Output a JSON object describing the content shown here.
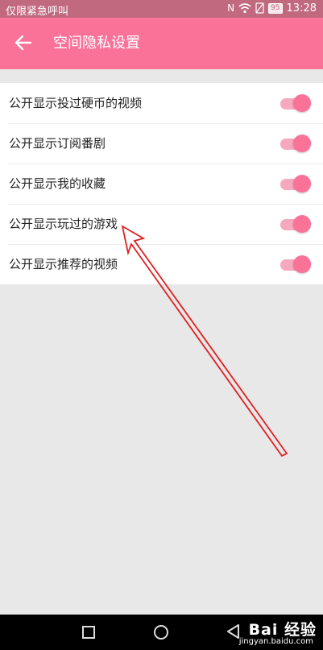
{
  "status_bar": {
    "carrier_text": "仅限紧急呼叫",
    "battery_level": "95",
    "time": "13:28",
    "icons": [
      "nfc-icon",
      "wifi-icon",
      "no-sim-icon",
      "battery-icon"
    ]
  },
  "app_bar": {
    "title": "空间隐私设置",
    "back_icon": "arrow-left-icon",
    "background_color": "#fb7299"
  },
  "settings": {
    "items": [
      {
        "label": "公开显示投过硬币的视频",
        "enabled": true
      },
      {
        "label": "公开显示订阅番剧",
        "enabled": true
      },
      {
        "label": "公开显示我的收藏",
        "enabled": true
      },
      {
        "label": "公开显示玩过的游戏",
        "enabled": true
      },
      {
        "label": "公开显示推荐的视频",
        "enabled": true
      }
    ]
  },
  "annotation": {
    "arrow_color": "#e02020"
  },
  "nav_bar": {
    "buttons": [
      "recents-square-icon",
      "home-circle-icon",
      "back-triangle-icon"
    ]
  },
  "watermark": {
    "main": "Bai 经验",
    "sub": "jingyan.baidu.com"
  }
}
